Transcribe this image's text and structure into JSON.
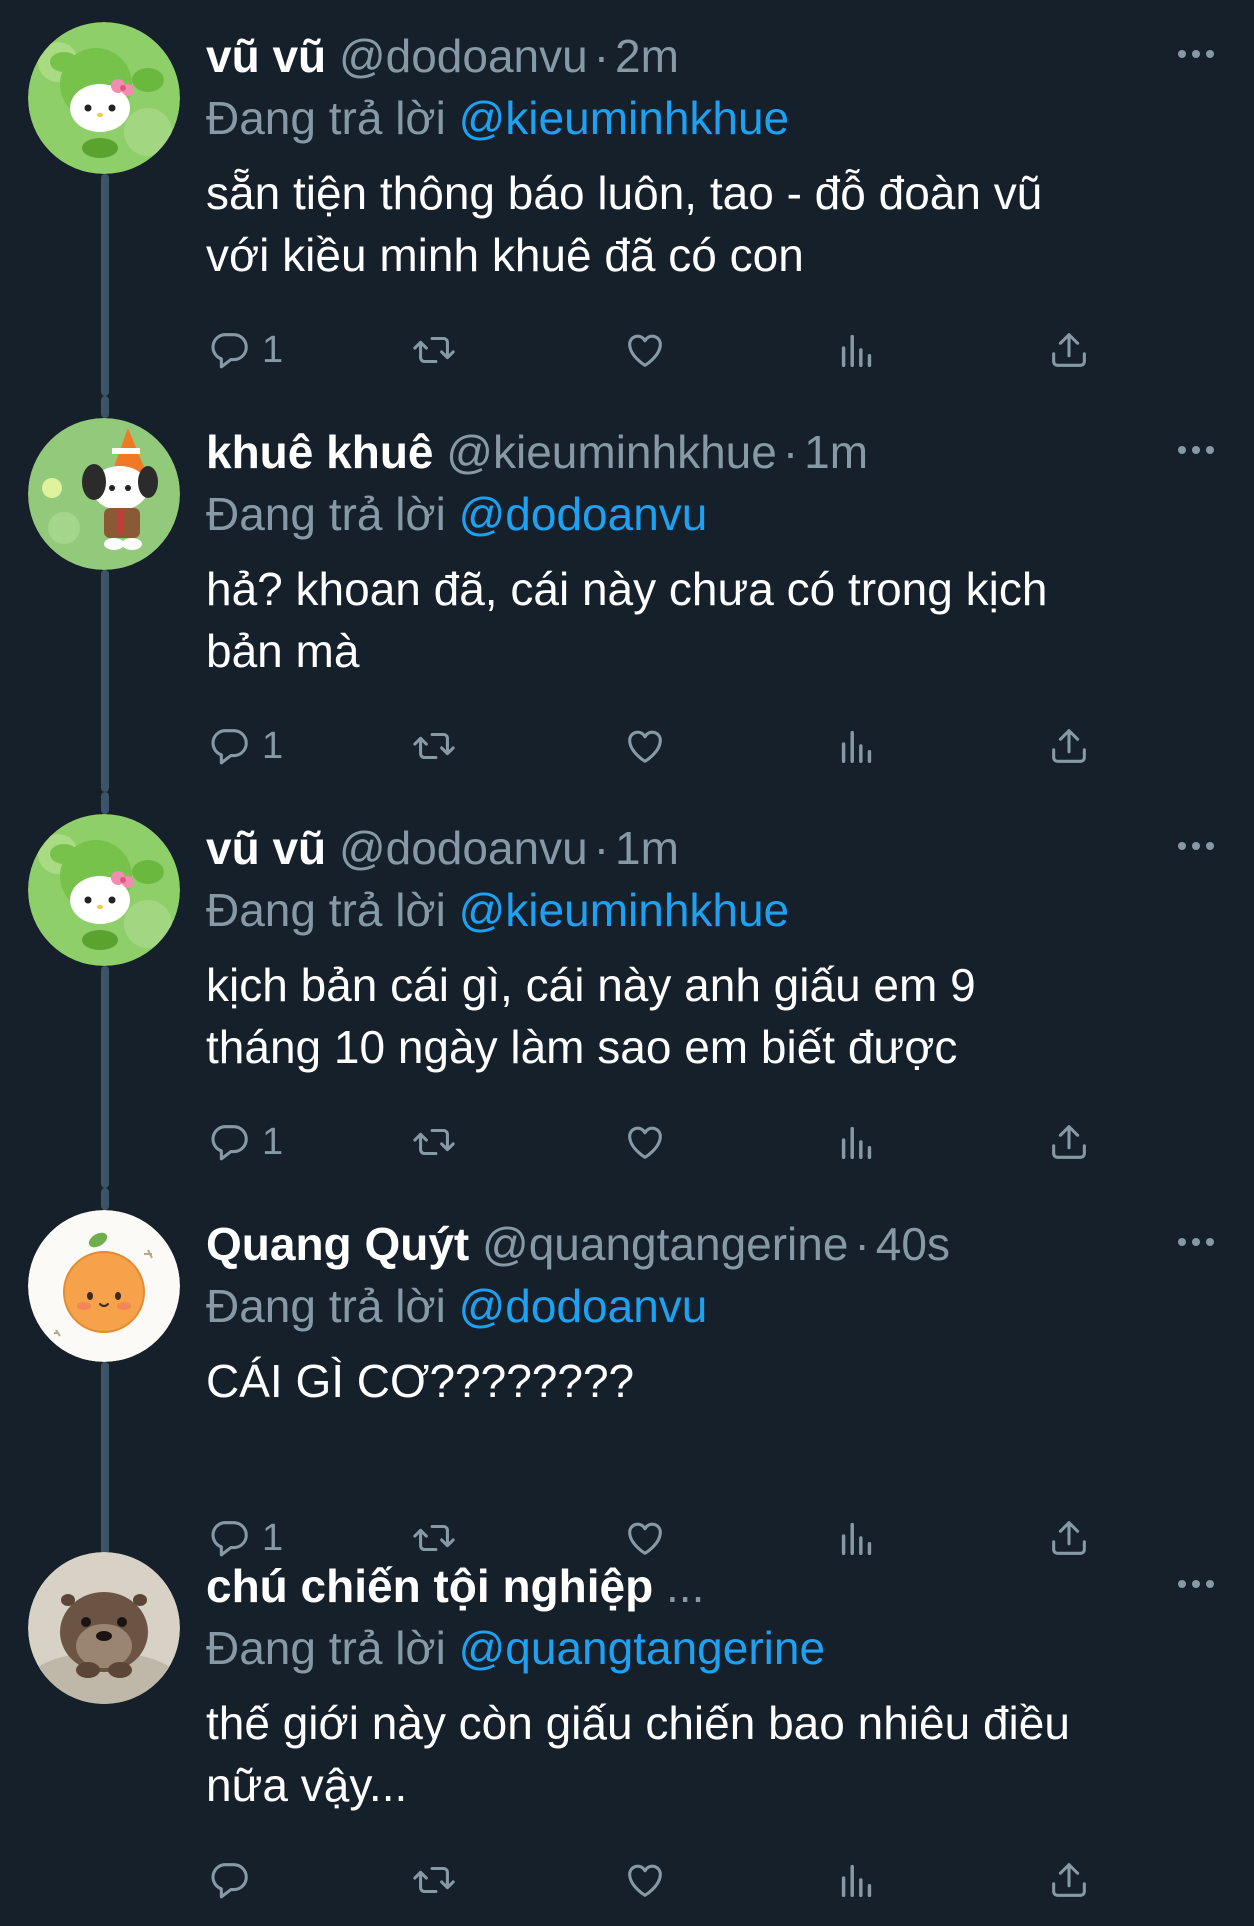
{
  "theme": {
    "background": "#15202b",
    "muted": "#8899a6",
    "accent": "#1da1f2",
    "thread_line": "#3d5466"
  },
  "reply_prefix": "Đang trả lời",
  "tweets": [
    {
      "name": "vũ vũ",
      "handle": "@dodoanvu",
      "time": "2m",
      "reply_to": "@kieuminhkhue",
      "text": "sẵn tiện thông báo luôn, tao - đỗ đoàn vũ\nvới kiều minh khuê đã có con",
      "reply_count": "1",
      "avatar": "hello-kitty-peashooter-avatar"
    },
    {
      "name": "khuê khuê",
      "handle": "@kieuminhkhue",
      "time": "1m",
      "reply_to": "@dodoanvu",
      "text": "hả? khoan đã, cái này chưa có trong kịch\nbản mà",
      "reply_count": "1",
      "avatar": "pochacco-cone-hat-avatar"
    },
    {
      "name": "vũ vũ",
      "handle": "@dodoanvu",
      "time": "1m",
      "reply_to": "@kieuminhkhue",
      "text": "kịch bản cái gì, cái này anh giấu em 9\ntháng 10 ngày làm sao em biết được",
      "reply_count": "1",
      "avatar": "hello-kitty-peashooter-avatar"
    },
    {
      "name": "Quang Quýt",
      "handle": "@quangtangerine",
      "time": "40s",
      "reply_to": "@dodoanvu",
      "text": "CÁI GÌ CƠ????????",
      "reply_count": "1",
      "avatar": "tangerine-avatar"
    },
    {
      "name": "chú chiến tội nghiệp",
      "ellipsis": "...",
      "reply_to": "@quangtangerine",
      "text": "thế giới này còn giấu chiến bao nhiêu điều\nnữa vậy...",
      "reply_count": "",
      "avatar": "otter-avatar"
    }
  ]
}
